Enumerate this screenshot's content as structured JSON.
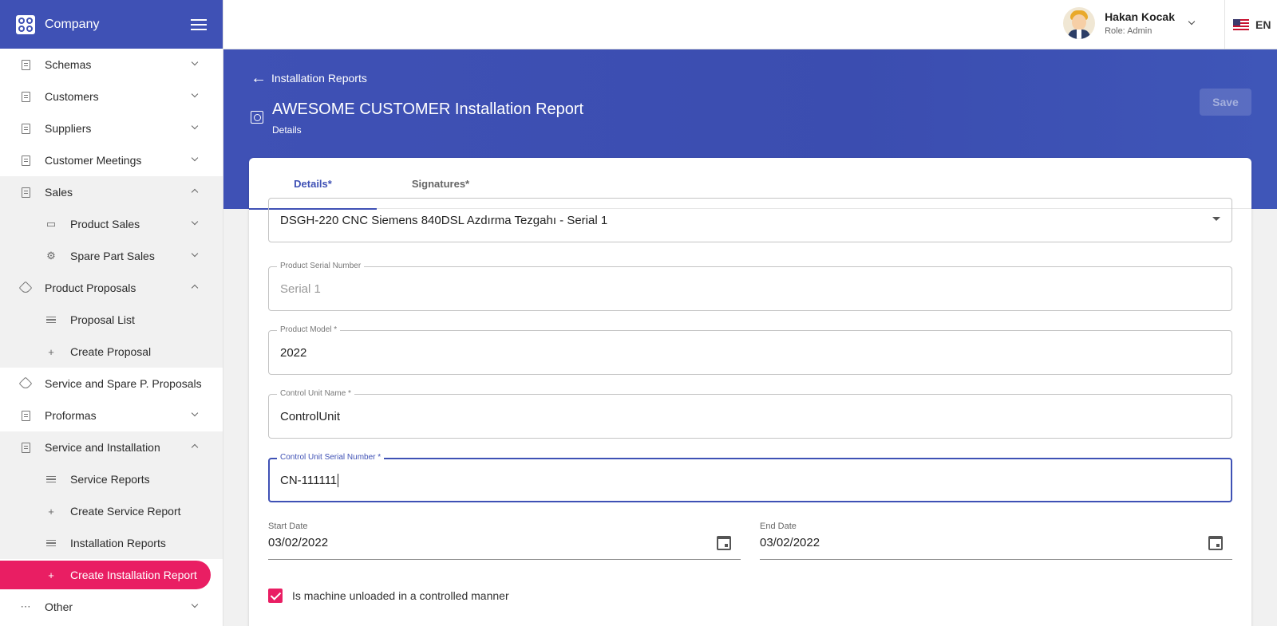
{
  "brand": {
    "name": "Company"
  },
  "sidebar": {
    "items": [
      {
        "label": "Schemas"
      },
      {
        "label": "Customers"
      },
      {
        "label": "Suppliers"
      },
      {
        "label": "Customer Meetings"
      },
      {
        "label": "Sales"
      },
      {
        "label": "Product Sales"
      },
      {
        "label": "Spare Part Sales"
      },
      {
        "label": "Product Proposals"
      },
      {
        "label": "Proposal List"
      },
      {
        "label": "Create Proposal"
      },
      {
        "label": "Service and Spare P. Proposals"
      },
      {
        "label": "Proformas"
      },
      {
        "label": "Service and Installation"
      },
      {
        "label": "Service Reports"
      },
      {
        "label": "Create Service Report"
      },
      {
        "label": "Installation Reports"
      },
      {
        "label": "Create Installation Report"
      },
      {
        "label": "Other"
      }
    ]
  },
  "user": {
    "name": "Hakan Kocak",
    "role": "Role: Admin"
  },
  "language": {
    "code": "EN"
  },
  "header": {
    "back_label": "Installation Reports",
    "title": "AWESOME CUSTOMER Installation Report",
    "subtitle": "Details",
    "save_label": "Save"
  },
  "tabs": [
    {
      "label": "Details*",
      "active": true
    },
    {
      "label": "Signatures*",
      "active": false
    }
  ],
  "form": {
    "product_select": {
      "value": "DSGH-220 CNC Siemens 840DSL Azdırma Tezgahı - Serial 1"
    },
    "serial_number": {
      "label": "Product Serial Number",
      "value": "Serial 1"
    },
    "product_model": {
      "label": "Product Model *",
      "value": "2022"
    },
    "control_unit_name": {
      "label": "Control Unit Name *",
      "value": "ControlUnit"
    },
    "control_unit_serial": {
      "label": "Control Unit Serial Number *",
      "value": "CN-111111"
    },
    "start_date": {
      "label": "Start Date",
      "value": "03/02/2022"
    },
    "end_date": {
      "label": "End Date",
      "value": "03/02/2022"
    },
    "unloaded_checkbox": {
      "label": "Is machine unloaded in a controlled manner",
      "checked": true
    }
  },
  "colors": {
    "primary": "#3f51b5",
    "accent": "#e91e63"
  }
}
